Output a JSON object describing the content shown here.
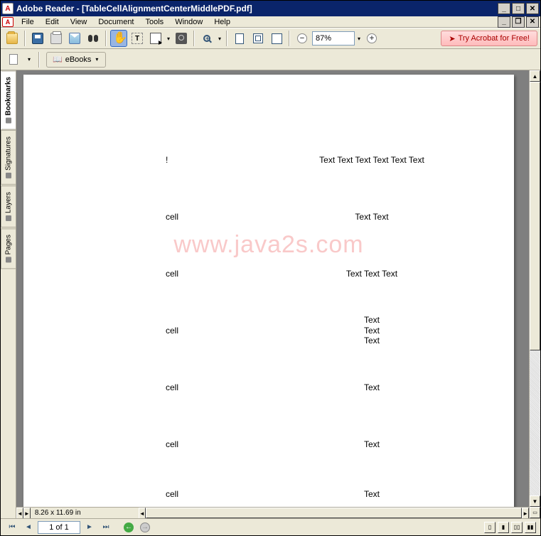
{
  "title": "Adobe Reader - [TableCellAlignmentCenterMiddlePDF.pdf]",
  "menu": {
    "file": "File",
    "edit": "Edit",
    "view": "View",
    "document": "Document",
    "tools": "Tools",
    "window": "Window",
    "help": "Help"
  },
  "toolbar": {
    "zoom_value": "87%",
    "acrobat_label": "Try Acrobat for Free!",
    "ebooks_label": "eBooks"
  },
  "nav_tabs": {
    "bookmarks": "Bookmarks",
    "signatures": "Signatures",
    "layers": "Layers",
    "pages": "Pages"
  },
  "page_nav": {
    "current": "1 of 1"
  },
  "page_dims": "8.26 x 11.69 in",
  "watermark": "www.java2s.com",
  "document": {
    "rows": [
      {
        "left": "!",
        "right": "Text Text Text Text Text Text"
      },
      {
        "left": "cell",
        "right": "Text Text"
      },
      {
        "left": "cell",
        "right": "Text Text Text"
      },
      {
        "left": "cell",
        "right_stack": [
          "Text",
          "Text",
          "Text"
        ]
      },
      {
        "left": "cell",
        "right": "Text"
      },
      {
        "left": "cell",
        "right": "Text"
      },
      {
        "left": "cell",
        "right": "Text"
      }
    ]
  }
}
